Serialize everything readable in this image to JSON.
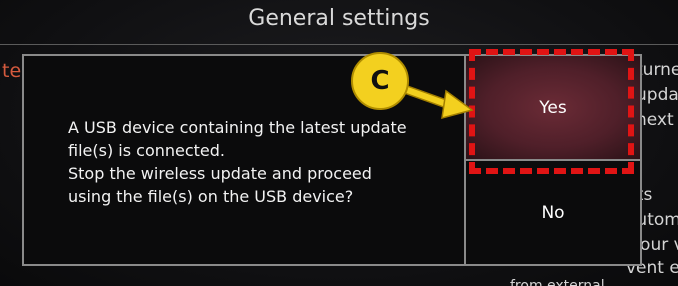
{
  "header": {
    "title": "General settings"
  },
  "background": {
    "left_fragment": "te",
    "right_fragments": [
      "turne",
      "upda",
      "next",
      "nts",
      "automa",
      "your v",
      "vent ex",
      "from external"
    ]
  },
  "dialog": {
    "message": [
      "A USB device containing the latest update",
      "file(s) is connected.",
      "Stop the wireless update and proceed",
      "using the file(s) on the USB device?"
    ],
    "yes_label": "Yes",
    "no_label": "No"
  },
  "annotation": {
    "callout_label": "C",
    "highlight_color": "#e01414",
    "callout_color": "#f3d01f"
  }
}
